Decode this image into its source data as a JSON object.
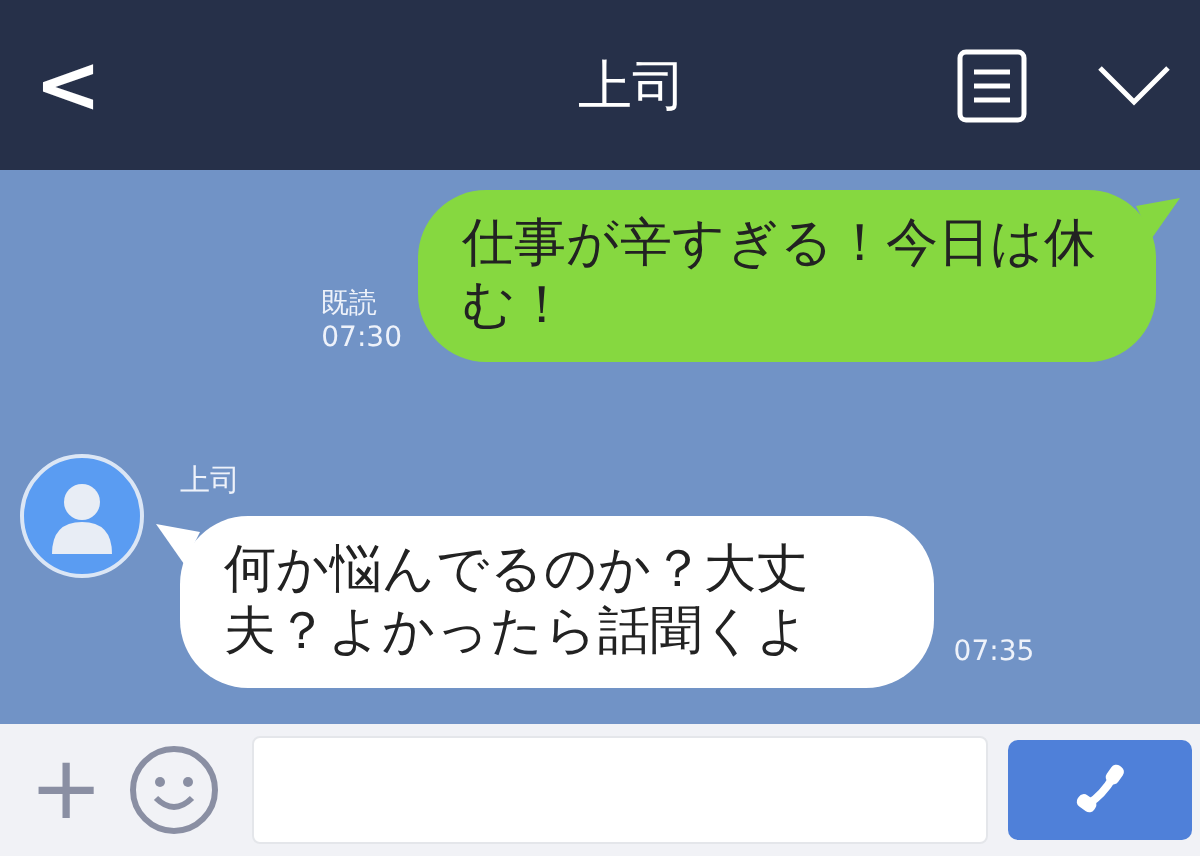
{
  "header": {
    "back": "<",
    "title": "上司"
  },
  "messages": [
    {
      "kind": "sent",
      "text": "仕事が辛すぎる！今日は休む！",
      "read": "既読",
      "time": "07:30"
    },
    {
      "kind": "received",
      "sender": "上司",
      "text": "何か悩んでるのか？大丈夫？よかったら話聞くよ",
      "time": "07:35"
    }
  ],
  "input": {
    "plus": "+"
  }
}
